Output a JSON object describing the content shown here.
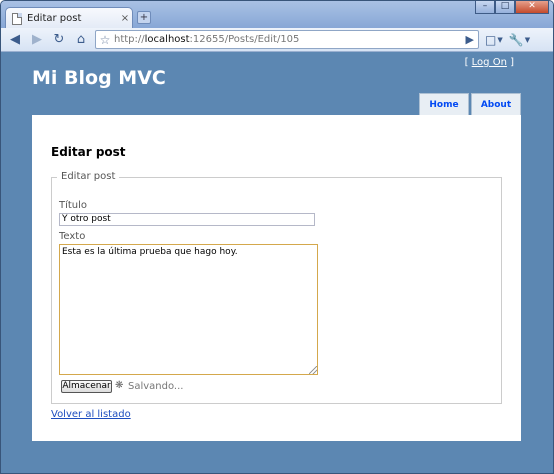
{
  "browser": {
    "tab_title": "Editar post",
    "tab_close": "×",
    "new_tab": "+",
    "window_buttons": {
      "minimize": "–",
      "maximize": "□",
      "close": "✕"
    },
    "url_prefix": "http://",
    "url_host": "localhost",
    "url_rest": ":12655/Posts/Edit/105"
  },
  "site": {
    "title": "Mi Blog MVC",
    "login_open": "[",
    "login_link": "Log On",
    "login_close": "]",
    "menu": [
      {
        "label": "Home"
      },
      {
        "label": "About"
      }
    ]
  },
  "form": {
    "heading": "Editar post",
    "legend": "Editar post",
    "titulo_label": "Título",
    "titulo_value": "Y otro post",
    "texto_label": "Texto",
    "texto_value": "Esta es la última prueba que hago hoy.",
    "submit_label": "Almacenar",
    "status_text": "Salvando..."
  },
  "back_link": "Volver al listado"
}
